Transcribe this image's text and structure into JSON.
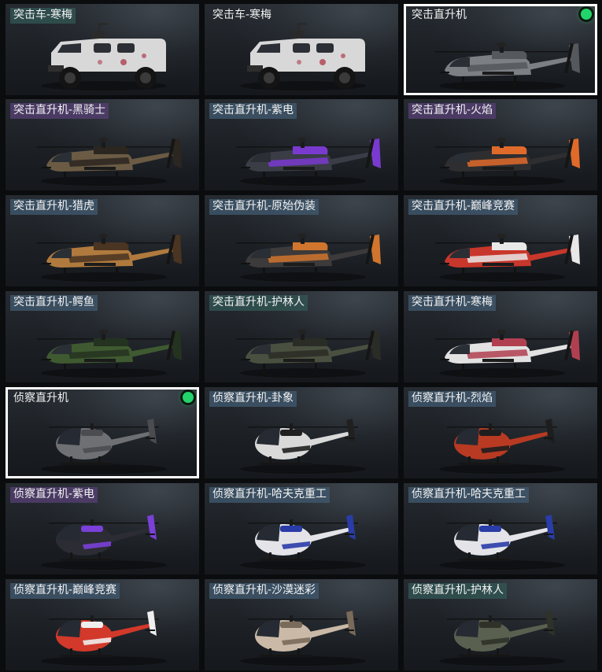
{
  "items": [
    {
      "label": "突击车-寒梅",
      "kind": "truck",
      "labelColor": "teal",
      "selected": false,
      "equipped": false,
      "body": "#d8d8d8",
      "accent": "#b04050"
    },
    {
      "label": "突击车-寒梅",
      "kind": "truck",
      "labelColor": "none",
      "selected": false,
      "equipped": false,
      "body": "#d8d8d8",
      "accent": "#b04050"
    },
    {
      "label": "突击直升机",
      "kind": "apache",
      "labelColor": "none",
      "selected": true,
      "equipped": true,
      "body": "#7c7f84",
      "accent": "#55585c"
    },
    {
      "label": "突击直升机-黑骑士",
      "kind": "apache",
      "labelColor": "purple",
      "selected": false,
      "equipped": false,
      "body": "#6b5b44",
      "accent": "#2b2620"
    },
    {
      "label": "突击直升机-紫电",
      "kind": "apache",
      "labelColor": "blue",
      "selected": false,
      "equipped": false,
      "body": "#3a3d46",
      "accent": "#7a3ad0"
    },
    {
      "label": "突击直升机-火焰",
      "kind": "apache",
      "labelColor": "purple",
      "selected": false,
      "equipped": false,
      "body": "#2e2e30",
      "accent": "#e06a2a"
    },
    {
      "label": "突击直升机-猎虎",
      "kind": "apache",
      "labelColor": "blue",
      "selected": false,
      "equipped": false,
      "body": "#b07a3e",
      "accent": "#4a3422"
    },
    {
      "label": "突击直升机-原始伪装",
      "kind": "apache",
      "labelColor": "blue",
      "selected": false,
      "equipped": false,
      "body": "#3c3a3a",
      "accent": "#d0752e"
    },
    {
      "label": "突击直升机-巅峰竞赛",
      "kind": "apache",
      "labelColor": "blue",
      "selected": false,
      "equipped": false,
      "body": "#c8372b",
      "accent": "#e8e8e8"
    },
    {
      "label": "突击直升机-鳄鱼",
      "kind": "apache",
      "labelColor": "blue",
      "selected": false,
      "equipped": false,
      "body": "#3f5a30",
      "accent": "#243220"
    },
    {
      "label": "突击直升机-护林人",
      "kind": "apache",
      "labelColor": "teal",
      "selected": false,
      "equipped": false,
      "body": "#4a5040",
      "accent": "#2a2c26"
    },
    {
      "label": "突击直升机-寒梅",
      "kind": "apache",
      "labelColor": "blue",
      "selected": false,
      "equipped": false,
      "body": "#e2e2e2",
      "accent": "#b04050"
    },
    {
      "label": "侦察直升机",
      "kind": "scout",
      "labelColor": "none",
      "selected": true,
      "equipped": true,
      "body": "#6e7074",
      "accent": "#4a4c50"
    },
    {
      "label": "侦察直升机-卦象",
      "kind": "scout",
      "labelColor": "blue",
      "selected": false,
      "equipped": false,
      "body": "#d9d9d9",
      "accent": "#202020"
    },
    {
      "label": "侦察直升机-烈焰",
      "kind": "scout",
      "labelColor": "blue",
      "selected": false,
      "equipped": false,
      "body": "#b83a22",
      "accent": "#1e1e1e"
    },
    {
      "label": "侦察直升机-紫电",
      "kind": "scout",
      "labelColor": "purple",
      "selected": false,
      "equipped": false,
      "body": "#2c2c34",
      "accent": "#7a40d8"
    },
    {
      "label": "侦察直升机-哈夫克重工",
      "kind": "scout",
      "labelColor": "blue",
      "selected": false,
      "equipped": false,
      "body": "#e4e4e8",
      "accent": "#2a3ca8"
    },
    {
      "label": "侦察直升机-哈夫克重工",
      "kind": "scout",
      "labelColor": "blue",
      "selected": false,
      "equipped": false,
      "body": "#e4e4e8",
      "accent": "#2a3ca8"
    },
    {
      "label": "侦察直升机-巅峰竞赛",
      "kind": "scout",
      "labelColor": "blue",
      "selected": false,
      "equipped": false,
      "body": "#d2392a",
      "accent": "#eeeeee"
    },
    {
      "label": "侦察直升机-沙漠迷彩",
      "kind": "scout",
      "labelColor": "blue",
      "selected": false,
      "equipped": false,
      "body": "#c9b9a6",
      "accent": "#7a6a5a"
    },
    {
      "label": "侦察直升机-护林人",
      "kind": "scout",
      "labelColor": "teal",
      "selected": false,
      "equipped": false,
      "body": "#5a6050",
      "accent": "#2e3228"
    }
  ]
}
